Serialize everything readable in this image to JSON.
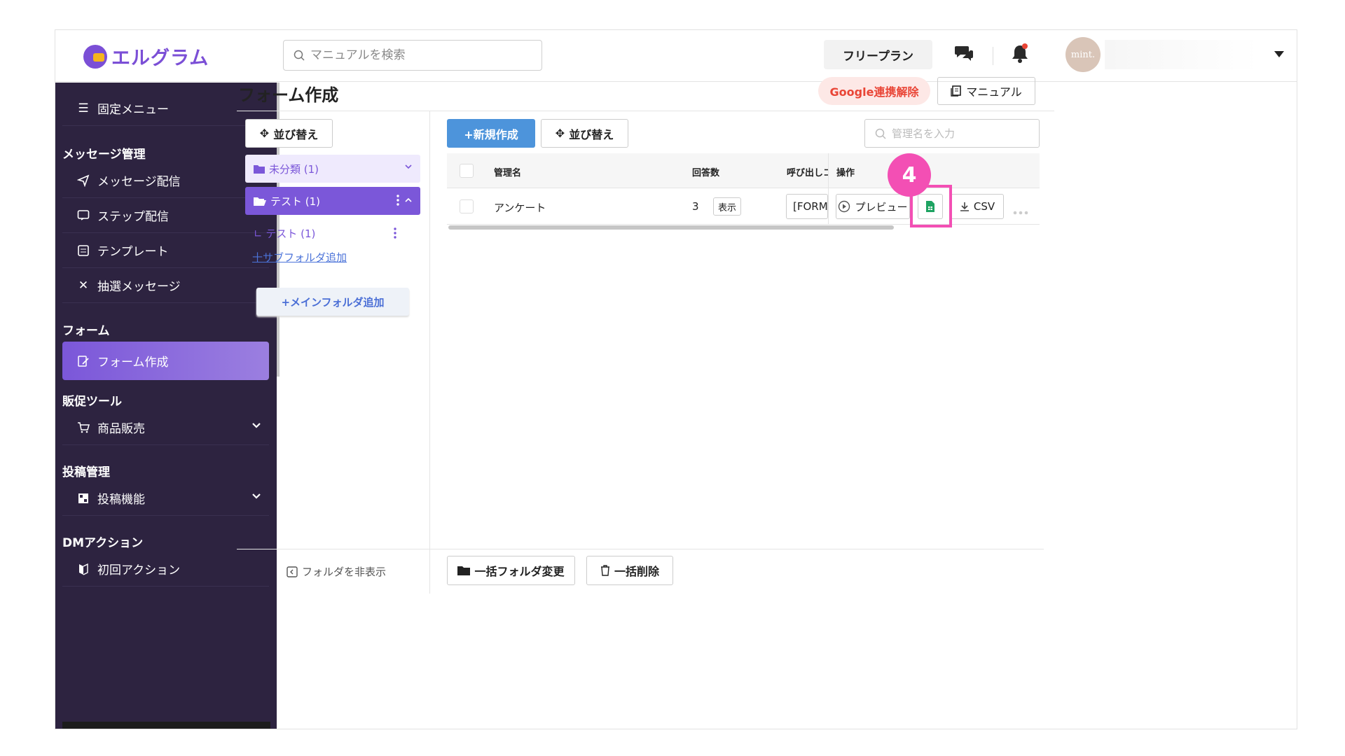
{
  "header": {
    "brand": "エルグラム",
    "search_placeholder": "マニュアルを検索",
    "plan": "フリープラン",
    "avatar_text": "mint."
  },
  "sidebar": {
    "fixed_menu": "固定メニュー",
    "sections": [
      {
        "title": "メッセージ管理",
        "items": [
          "メッセージ配信",
          "ステップ配信",
          "テンプレート",
          "抽選メッセージ"
        ]
      },
      {
        "title": "フォーム",
        "items": [
          "フォーム作成"
        ]
      },
      {
        "title": "販促ツール",
        "items": [
          "商品販売"
        ]
      },
      {
        "title": "投稿管理",
        "items": [
          "投稿機能"
        ]
      },
      {
        "title": "DMアクション",
        "items": [
          "初回アクション"
        ]
      }
    ],
    "collapse_label": "<="
  },
  "main": {
    "title": "フォーム作成",
    "google_btn": "Google連携解除",
    "manual_btn": "マニュアル",
    "sort_btn": "並び替え",
    "new_btn": "+新規作成",
    "filter_placeholder": "管理名を入力",
    "folders": [
      {
        "label": "未分類 (1)"
      },
      {
        "label": "テスト (1)"
      }
    ],
    "subfolder": "∟ テスト (1)",
    "add_subfolder": "十サブフォルダ追加",
    "add_mainfolder": "+メインフォルダ追加",
    "table": {
      "headers": [
        "管理名",
        "回答数",
        "呼び出しコ",
        "操作"
      ],
      "rows": [
        {
          "name": "アンケート",
          "count": "3",
          "show": "表示",
          "code": "[FORM_",
          "preview": "プレビュー",
          "csv": "CSV"
        }
      ]
    },
    "badge": "4",
    "hide_folders": "フォルダを非表示",
    "bulk_folder": "一括フォルダ変更",
    "bulk_delete": "一括削除"
  },
  "colors": {
    "accent": "#7b57d9",
    "sidebar": "#2d2340",
    "primary": "#4d94db",
    "highlight": "#f34fb4",
    "google": "#e94536"
  }
}
